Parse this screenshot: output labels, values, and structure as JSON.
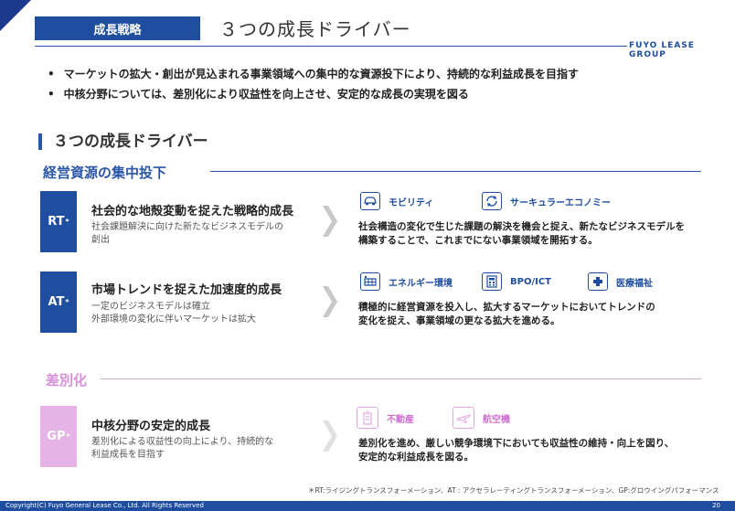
{
  "header": {
    "section_tag": "成長戦略",
    "title": "３つの成長ドライバー",
    "brand": "FUYO LEASE GROUP"
  },
  "bullets": [
    "マーケットの拡大・創出が見込まれる事業領域への集中的な資源投下により、持続的な利益成長を目指す",
    "中核分野については、差別化により収益性を向上させ、安定的な成長の実現を図る"
  ],
  "subheading": "３つの成長ドライバー",
  "categories": {
    "concentration": "経営資源の集中投下",
    "differentiation": "差別化"
  },
  "drivers": [
    {
      "badge": "RT",
      "mark": "*",
      "title": "社会的な地殻変動を捉えた戦略的成長",
      "sub_lines": [
        "社会課題解決に向けた新たなビジネスモデルの",
        "創出"
      ],
      "tags": [
        {
          "label": "モビリティ",
          "icon": "car-icon"
        },
        {
          "label": "サーキュラーエコノミー",
          "icon": "recycle-icon"
        }
      ],
      "desc_lines": [
        "社会構造の変化で生じた課題の解決を機会と捉え、新たなビジネスモデルを",
        "構築することで、これまでにない事業領域を開拓する。"
      ]
    },
    {
      "badge": "AT",
      "mark": "*",
      "title": "市場トレンドを捉えた加速度的成長",
      "sub_lines": [
        "一定のビジネスモデルは確立",
        "外部環境の変化に伴いマーケットは拡大"
      ],
      "tags": [
        {
          "label": "エネルギー環境",
          "icon": "solar-panel-icon"
        },
        {
          "label": "BPO/ICT",
          "icon": "calculator-icon"
        },
        {
          "label": "医療福祉",
          "icon": "medical-icon"
        }
      ],
      "desc_lines": [
        "積極的に経営資源を投入し、拡大するマーケットにおいてトレンドの",
        "変化を捉え、事業領域の更なる拡大を進める。"
      ]
    },
    {
      "badge": "GP",
      "mark": "*",
      "title": "中核分野の安定的成長",
      "sub_lines": [
        "差別化による収益性の向上により、持続的な",
        "利益成長を目指す"
      ],
      "tags": [
        {
          "label": "不動産",
          "icon": "building-icon"
        },
        {
          "label": "航空機",
          "icon": "airplane-icon"
        }
      ],
      "desc_lines": [
        "差別化を進め、厳しい競争環境下においても収益性の維持・向上を図り、",
        "安定的な利益成長を図る。"
      ]
    }
  ],
  "footnote": "＊RT:ライジングトランスフォーメーション、AT : アクセラレーティングトランスフォーメーション、GP:グロウイングパフォーマンス",
  "footer": {
    "copyright": "Copyright(C) Fuyo General Lease Co., Ltd. All Rights Reserved",
    "page_number": "20"
  },
  "colors": {
    "brand_blue": "#1f4ea0",
    "accent_pink": "#e6b3e6",
    "differentiation_pink": "#d890d8"
  }
}
